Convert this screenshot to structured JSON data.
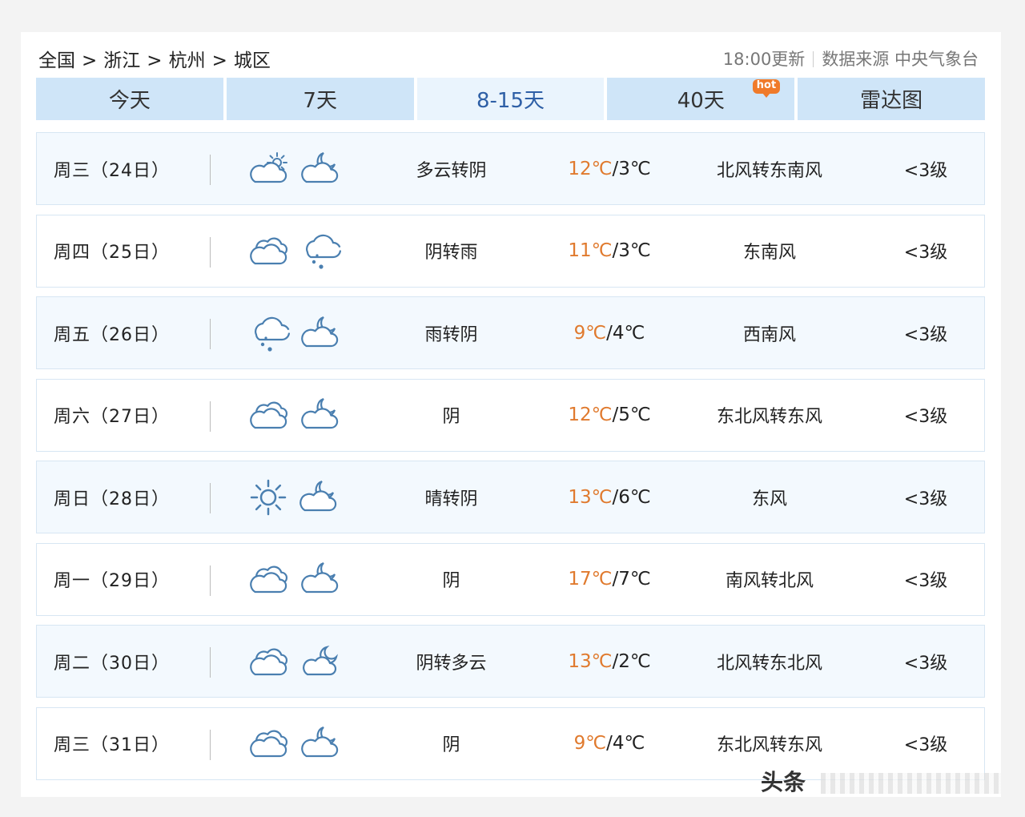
{
  "breadcrumb": [
    "全国",
    "浙江",
    "杭州",
    "城区"
  ],
  "breadcrumb_sep": ">",
  "update_time": "18:00更新",
  "data_source": "数据来源 中央气象台",
  "tabs": [
    {
      "label": "今天"
    },
    {
      "label": "7天"
    },
    {
      "label": "8-15天",
      "active": true
    },
    {
      "label": "40天",
      "badge": "hot"
    },
    {
      "label": "雷达图"
    }
  ],
  "forecast": [
    {
      "date": "周三（24日）",
      "icon_day": "partly-cloudy-icon",
      "icon_night": "cloudy-night-icon",
      "weather": "多云转阴",
      "high": "12℃",
      "low": "3℃",
      "wind": "北风转东南风",
      "level": "<3级"
    },
    {
      "date": "周四（25日）",
      "icon_day": "cloudy-icon",
      "icon_night": "rain-icon",
      "weather": "阴转雨",
      "high": "11℃",
      "low": "3℃",
      "wind": "东南风",
      "level": "<3级"
    },
    {
      "date": "周五（26日）",
      "icon_day": "rain-icon",
      "icon_night": "cloudy-night-icon",
      "weather": "雨转阴",
      "high": "9℃",
      "low": "4℃",
      "wind": "西南风",
      "level": "<3级"
    },
    {
      "date": "周六（27日）",
      "icon_day": "cloudy-icon",
      "icon_night": "cloudy-night-icon",
      "weather": "阴",
      "high": "12℃",
      "low": "5℃",
      "wind": "东北风转东风",
      "level": "<3级"
    },
    {
      "date": "周日（28日）",
      "icon_day": "sun-icon",
      "icon_night": "cloudy-night-icon",
      "weather": "晴转阴",
      "high": "13℃",
      "low": "6℃",
      "wind": "东风",
      "level": "<3级"
    },
    {
      "date": "周一（29日）",
      "icon_day": "cloudy-icon",
      "icon_night": "cloudy-night-icon",
      "weather": "阴",
      "high": "17℃",
      "low": "7℃",
      "wind": "南风转北风",
      "level": "<3级"
    },
    {
      "date": "周二（30日）",
      "icon_day": "cloudy-icon",
      "icon_night": "partly-cloudy-night-icon",
      "weather": "阴转多云",
      "high": "13℃",
      "low": "2℃",
      "wind": "北风转东北风",
      "level": "<3级"
    },
    {
      "date": "周三（31日）",
      "icon_day": "cloudy-icon",
      "icon_night": "cloudy-night-icon",
      "weather": "阴",
      "high": "9℃",
      "low": "4℃",
      "wind": "东北风转东风",
      "level": "<3级"
    }
  ],
  "watermark": "头条"
}
